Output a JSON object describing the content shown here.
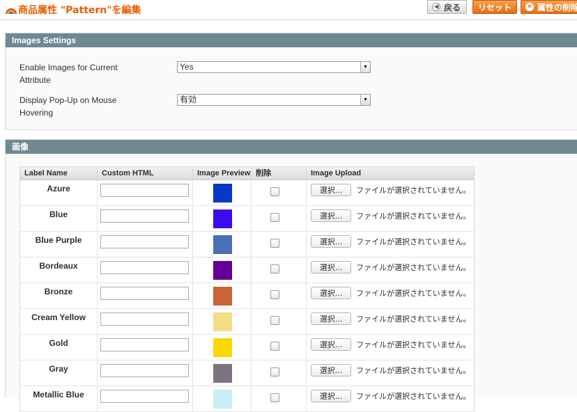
{
  "header": {
    "title": "商品属性 \"Pattern\"を編集",
    "back_label": "戻る",
    "reset_label": "リセット",
    "delete_label": "属性の削除"
  },
  "images_settings": {
    "title": "Images Settings",
    "enable_label": "Enable Images for Current Attribute",
    "enable_value": "Yes",
    "popup_label": "Display Pop-Up on Mouse Hovering",
    "popup_value": "有効"
  },
  "images_grid": {
    "title": "画像",
    "columns": [
      "Label Name",
      "Custom HTML",
      "Image Preview",
      "削除",
      "Image Upload"
    ],
    "browse_label": "選択...",
    "no_file_text": "ファイルが選択されていません。",
    "rows": [
      {
        "label": "Azure",
        "color": "#0838c7"
      },
      {
        "label": "Blue",
        "color": "#3a0bf0"
      },
      {
        "label": "Blue Purple",
        "color": "#4a6eb7"
      },
      {
        "label": "Bordeaux",
        "color": "#640097"
      },
      {
        "label": "Bronze",
        "color": "#c96534"
      },
      {
        "label": "Cream Yellow",
        "color": "#f3dd85"
      },
      {
        "label": "Gold",
        "color": "#fdd700"
      },
      {
        "label": "Gray",
        "color": "#7b747e"
      },
      {
        "label": "Metallic Blue",
        "color": "#c8eef6"
      }
    ]
  }
}
